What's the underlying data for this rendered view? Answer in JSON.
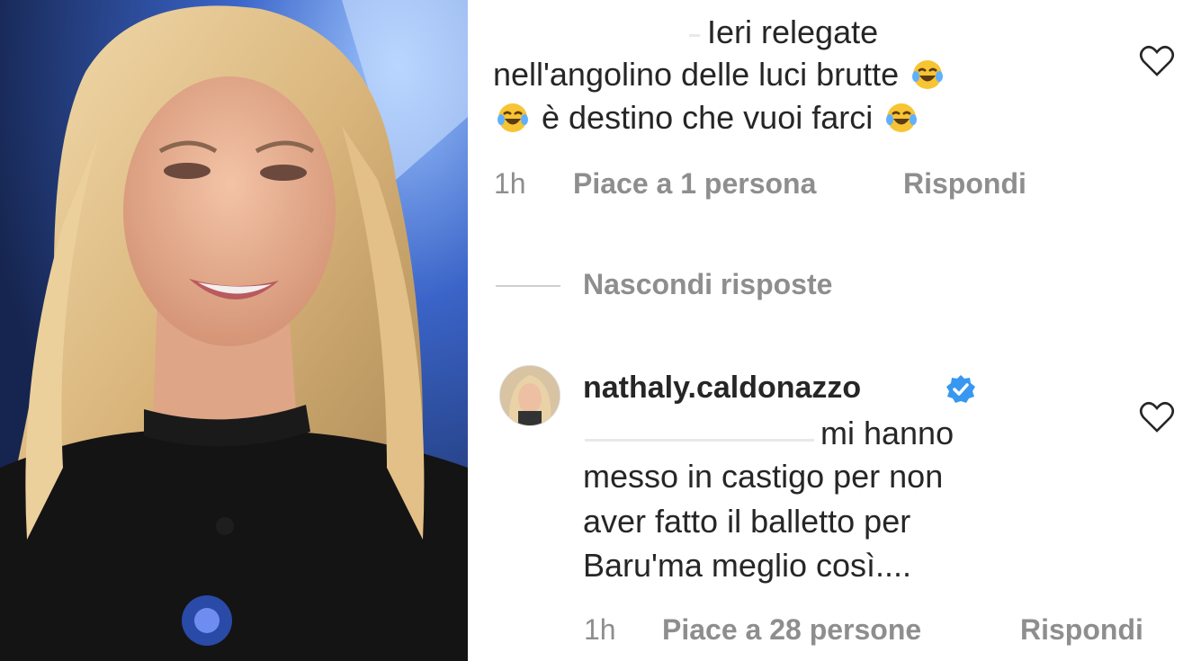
{
  "photo": {
    "alt": ""
  },
  "comment1": {
    "lines": [
      "Ieri relegate",
      "nell'angolino delle luci brutte",
      "è destino che vuoi farci"
    ],
    "time": "1h",
    "likes": "Piace a 1 persona",
    "reply": "Rispondi"
  },
  "toggle_replies": "Nascondi risposte",
  "reply1": {
    "username": "nathaly.caldonazzo",
    "lines": [
      "mi hanno",
      "messo in castigo per non",
      "aver fatto il balletto per",
      "Baru'ma meglio così...."
    ],
    "time": "1h",
    "likes": "Piace a 28 persone",
    "reply": "Rispondi"
  },
  "icons": [
    "heart-icon",
    "verified-badge-icon",
    "laughing-crying-emoji"
  ],
  "colors": {
    "text": "#262626",
    "muted": "#8e8e8e",
    "verified": "#3897f0"
  }
}
